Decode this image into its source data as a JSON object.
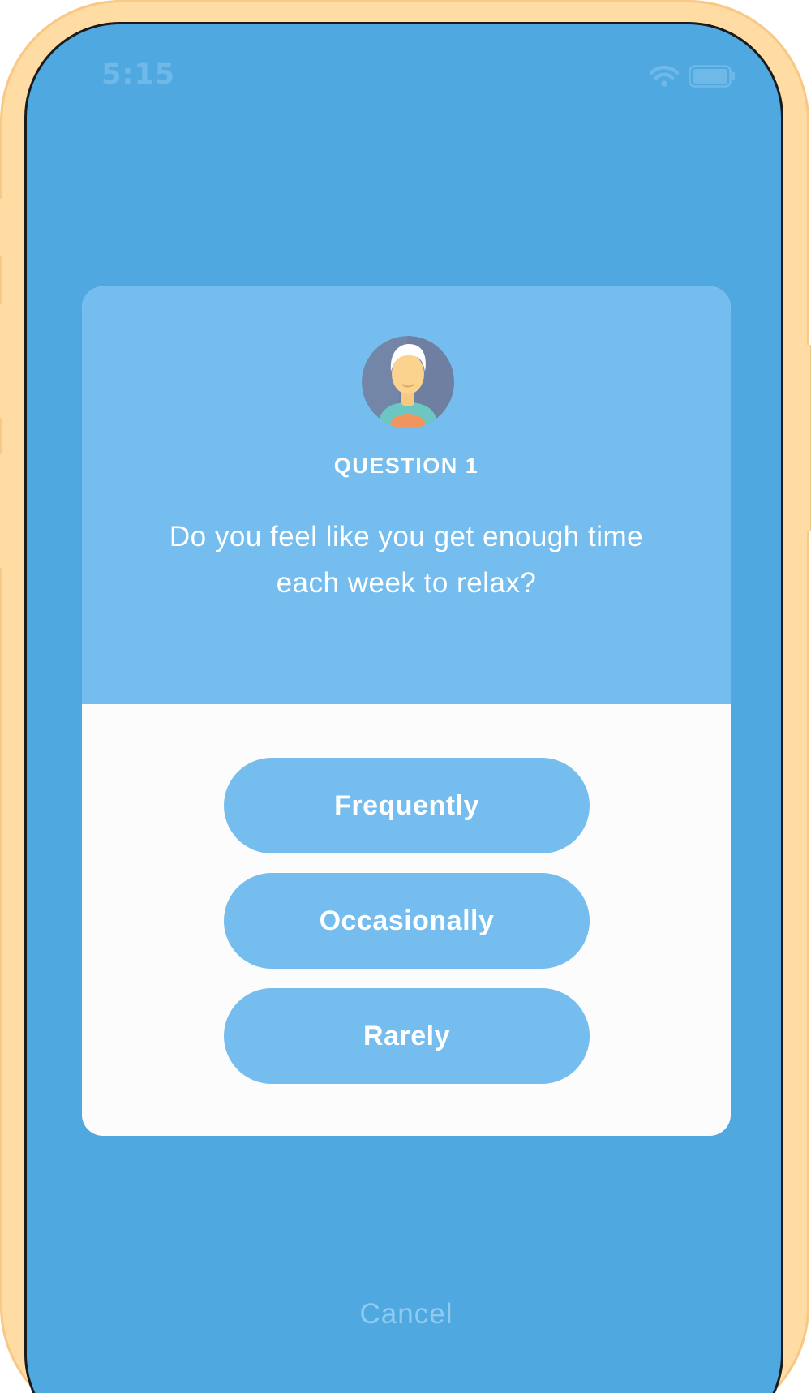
{
  "status_bar": {
    "time": "5:15",
    "icons": [
      "wifi-icon",
      "battery-icon"
    ]
  },
  "card": {
    "avatar_icon": "person-avatar-icon",
    "question_label": "QUESTION 1",
    "question_text": "Do you feel like you get enough time each week to relax?"
  },
  "answers": [
    {
      "label": "Frequently"
    },
    {
      "label": "Occasionally"
    },
    {
      "label": "Rarely"
    }
  ],
  "cancel_label": "Cancel",
  "colors": {
    "background": "#50A8E0",
    "card_header": "#74BDEE",
    "button": "#74BDEE",
    "card_body": "#FCFCFC",
    "frame": "#FFDCA4"
  }
}
